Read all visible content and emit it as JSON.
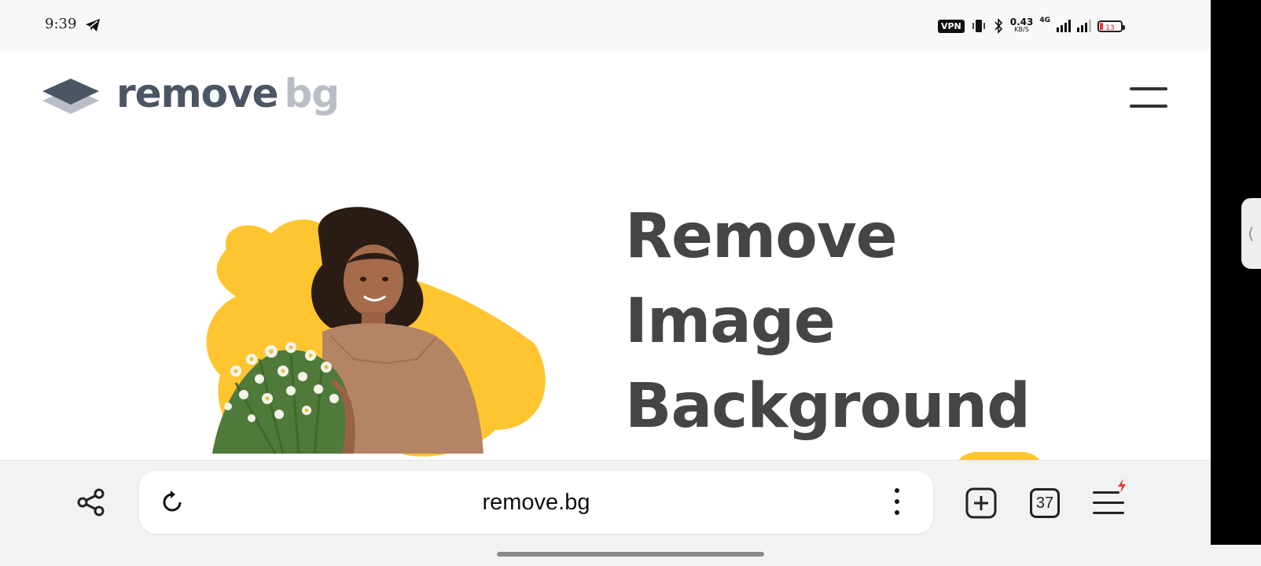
{
  "status_bar": {
    "time": "9:39",
    "vpn": "VPN",
    "net_speed_value": "0.43",
    "net_speed_unit": "KB/S",
    "network": "4G",
    "battery": "13"
  },
  "site": {
    "logo_primary": "remove",
    "logo_secondary": "bg",
    "headline": [
      "Remove",
      "Image",
      "Background"
    ],
    "colors": {
      "accent_yellow": "#ffc531",
      "logo_dark": "#4b5563",
      "logo_light": "#b9bec6",
      "headline": "#454545"
    }
  },
  "browser": {
    "url": "remove.bg",
    "tab_count": "37",
    "icons": [
      "share-icon",
      "reload-icon",
      "more-vertical-icon",
      "new-tab-icon",
      "tabs-counter-icon",
      "menu-icon"
    ]
  }
}
